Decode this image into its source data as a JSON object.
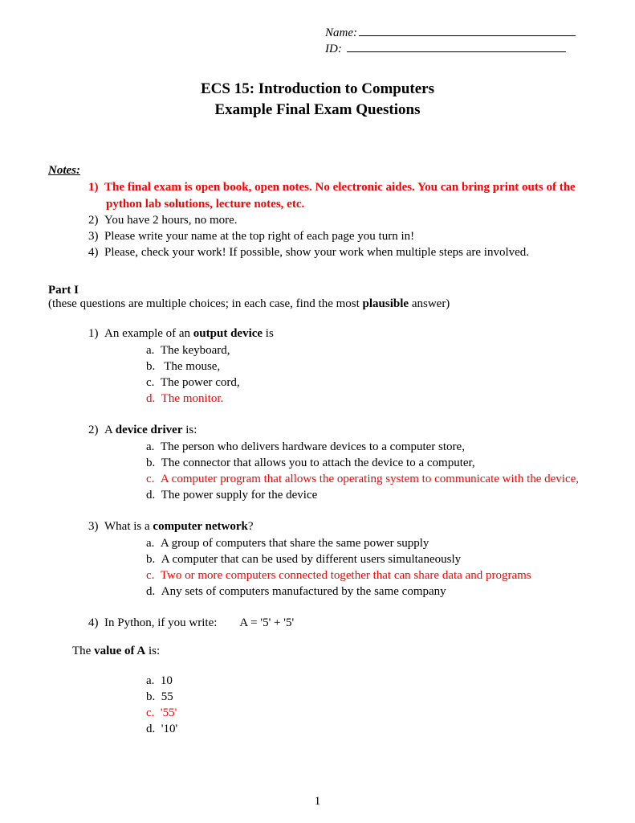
{
  "header": {
    "name_label": "Name:",
    "id_label": "ID:"
  },
  "title": {
    "line1": "ECS 15: Introduction to Computers",
    "line2": "Example Final Exam Questions"
  },
  "notes": {
    "label": "Notes:",
    "items": [
      {
        "num": "1)",
        "text_before": "The final exam is open book, open notes. No electronic aides. You can bring print outs of the python lab solutions, lecture notes, etc.",
        "red": true,
        "bold": true
      },
      {
        "num": "2)",
        "text_before": "You have 2 hours, no more."
      },
      {
        "num": "3)",
        "text_before": "Please write your name at the top right of each page you turn in!"
      },
      {
        "num": "4)",
        "text_before": "Please, check your work! If possible, show your work when multiple steps are involved."
      }
    ]
  },
  "part1": {
    "label": "Part I",
    "desc_pre": "(these questions are multiple choices; in each case, find the most ",
    "desc_bold": "plausible",
    "desc_post": " answer)"
  },
  "q1": {
    "num": "1)",
    "pre": "An example of an ",
    "bold": "output device",
    "post": " is",
    "opts": [
      {
        "l": "a.",
        "t": "The keyboard,"
      },
      {
        "l": "b.",
        "t": " The mouse,"
      },
      {
        "l": "c.",
        "t": "The power cord,"
      },
      {
        "l": "d.",
        "t": "The monitor.",
        "red": true
      }
    ]
  },
  "q2": {
    "num": "2)",
    "pre": "A ",
    "bold": "device driver",
    "post": " is:",
    "opts": [
      {
        "l": "a.",
        "t": "The person who delivers hardware devices to a computer store,"
      },
      {
        "l": "b.",
        "t": "The connector that allows you to attach the device to a computer,"
      },
      {
        "l": "c.",
        "t": "A computer program that allows the operating system to communicate with the device,",
        "red": true
      },
      {
        "l": "d.",
        "t": "The power supply for the device"
      }
    ]
  },
  "q3": {
    "num": "3)",
    "pre": "What is a ",
    "bold": "computer network",
    "post": "?",
    "opts": [
      {
        "l": "a.",
        "t": "A group of computers that share the same power supply"
      },
      {
        "l": "b.",
        "t": "A computer that can be used by different users simultaneously"
      },
      {
        "l": "c.",
        "t": "Two or more computers connected together that can share data and programs",
        "red": true
      },
      {
        "l": "d.",
        "t": "Any sets of computers manufactured by the same company"
      }
    ]
  },
  "q4": {
    "num": "4)",
    "pre": "In Python, if you write:",
    "code": "A = '5' + '5'",
    "value_pre": "The ",
    "value_bold": "value of A",
    "value_post": " is:",
    "opts": [
      {
        "l": "a.",
        "t": "10"
      },
      {
        "l": "b.",
        "t": "55"
      },
      {
        "l": "c.",
        "t": "'55'",
        "red": true
      },
      {
        "l": "d.",
        "t": "'10'"
      }
    ]
  },
  "page_number": "1"
}
